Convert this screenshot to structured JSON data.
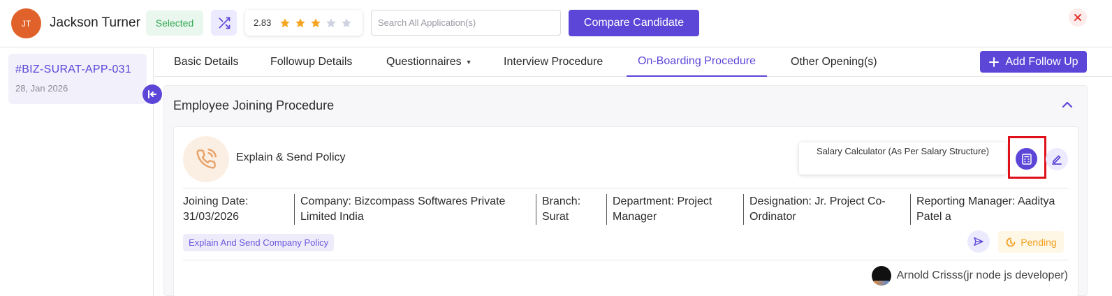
{
  "header": {
    "avatar_initials": "JT",
    "candidate_name": "Jackson Turner",
    "status": "Selected",
    "rating": "2.83",
    "rating_stars_filled": 3,
    "rating_stars_total": 5,
    "search_placeholder": "Search All Application(s)",
    "compare_label": "Compare Candidate"
  },
  "sidebar": {
    "application_id": "#BIZ-SURAT-APP-031",
    "application_date": "28, Jan 2026"
  },
  "tabs": [
    {
      "label": "Basic Details"
    },
    {
      "label": "Followup Details"
    },
    {
      "label": "Questionnaires"
    },
    {
      "label": "Interview Procedure"
    },
    {
      "label": "On-Boarding Procedure",
      "active": true
    },
    {
      "label": "Other Opening(s)"
    }
  ],
  "add_follow_up_label": "Add Follow Up",
  "section": {
    "title": "Employee Joining Procedure",
    "step": {
      "title": "Explain & Send Policy",
      "tooltip": "Salary Calculator (As Per Salary Structure)",
      "details": {
        "joining_date": "Joining Date: 31/03/2026",
        "company": "Company: Bizcompass Softwares Private Limited India",
        "branch": "Branch: Surat",
        "department": "Department: Project Manager",
        "designation": "Designation: Jr. Project Co-Ordinator",
        "reporting_manager": "Reporting Manager: Aaditya Patel a"
      },
      "tag": "Explain And Send Company Policy",
      "status": "Pending",
      "assignee": "Arnold Crisss(jr node js developer)"
    }
  },
  "colors": {
    "accent": "#5b46d8",
    "avatar": "#e0622a",
    "selected_text": "#34a853",
    "pending": "#f0a020",
    "star_filled": "#f5a623",
    "star_empty": "#cfd2e0",
    "close": "#e53935",
    "highlight": "#e0101a"
  }
}
